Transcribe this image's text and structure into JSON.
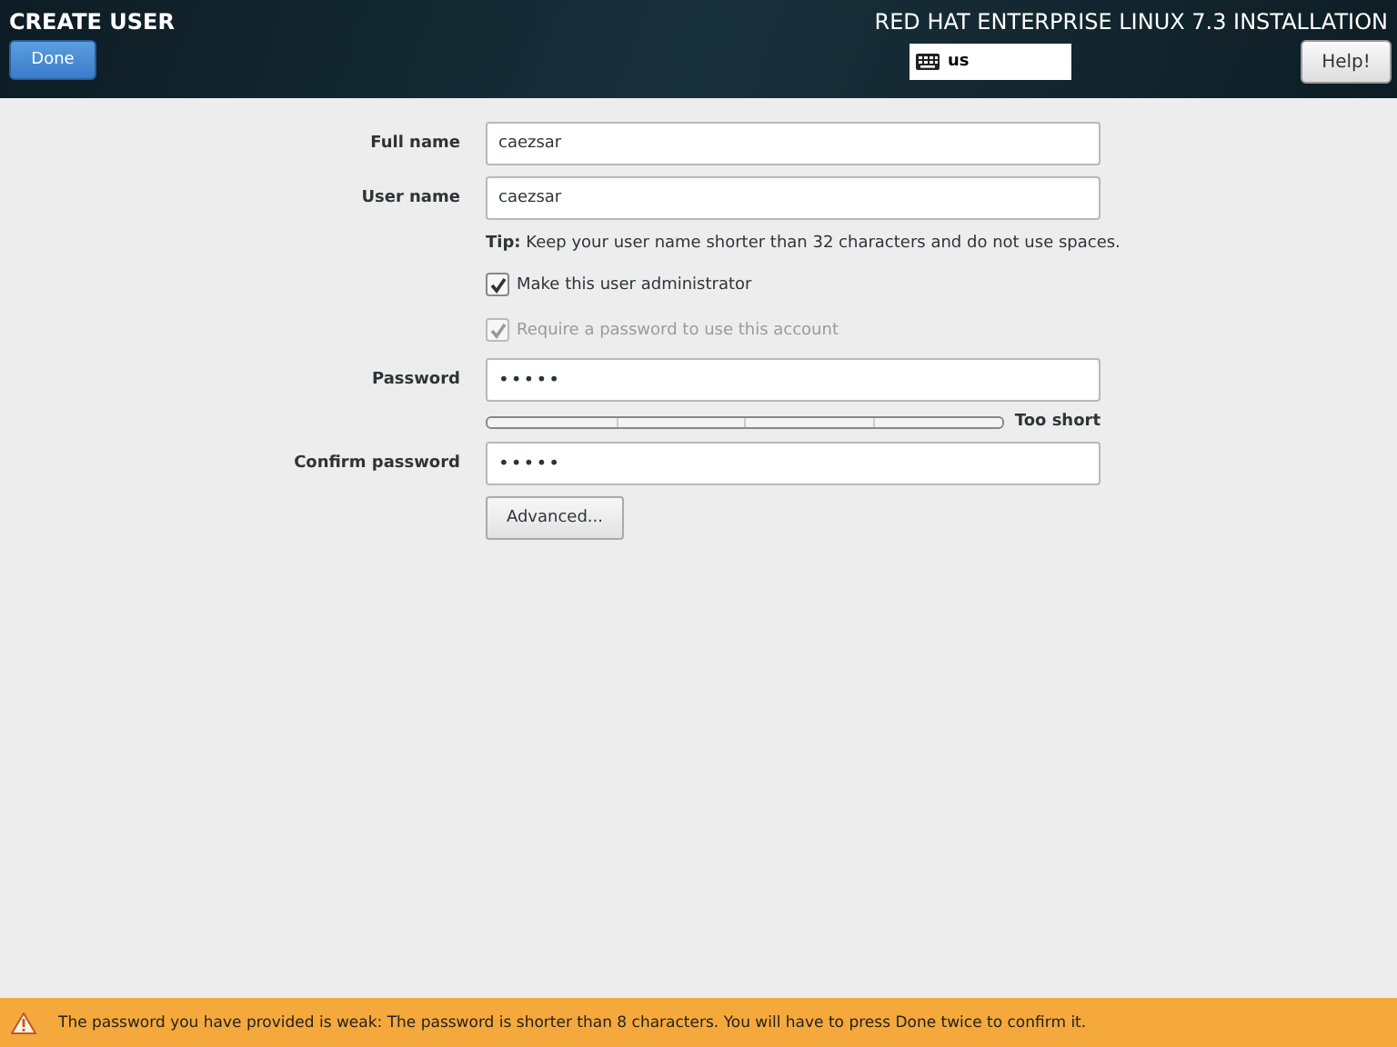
{
  "header": {
    "title": "CREATE USER",
    "done_button": "Done",
    "product": "RED HAT ENTERPRISE LINUX 7.3 INSTALLATION",
    "keyboard_layout": "us",
    "help_button": "Help!"
  },
  "form": {
    "full_name": {
      "label": "Full name",
      "value": "caezsar"
    },
    "user_name": {
      "label": "User name",
      "value": "caezsar"
    },
    "tip": "**Tip:** Keep your user name shorter than 32 characters and do not use spaces.",
    "checkboxes": [
      {
        "label": "Make this user administrator",
        "checked": true,
        "disabled": false
      },
      {
        "label": "Require a password to use this account",
        "checked": true,
        "disabled": true
      }
    ],
    "password": {
      "label": "Password",
      "value": "•••••"
    },
    "strength": {
      "reading": "Too short"
    },
    "confirm_password": {
      "label": "Confirm password",
      "value": "•••••"
    },
    "advanced_button": "Advanced..."
  },
  "warning_bar": {
    "message": "The password you have provided is weak: The password is shorter than 8 characters. You will have to press Done twice to confirm it."
  }
}
